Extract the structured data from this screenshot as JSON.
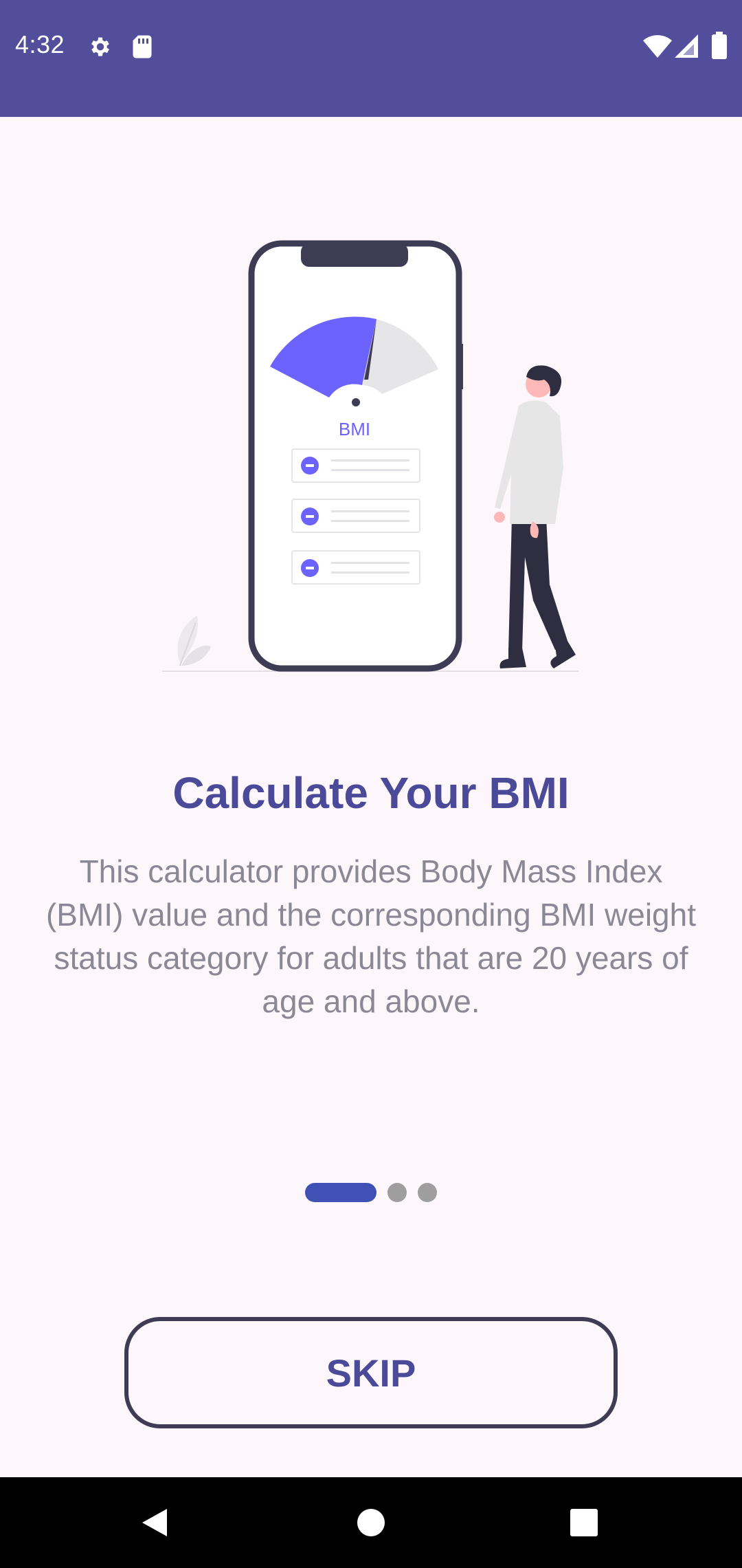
{
  "status_bar": {
    "time": "4:32",
    "icons": [
      "gear-icon",
      "sd-card-icon",
      "wifi-icon",
      "signal-icon",
      "battery-icon"
    ],
    "color": "#534e9b"
  },
  "illustration": {
    "gauge_label": "BMI",
    "accent_color": "#6c63ff"
  },
  "onboarding": {
    "title": "Calculate Your BMI",
    "description": "This calculator provides Body Mass Index (BMI) value and the corresponding BMI weight status category for adults that are 20 years of age and above.",
    "current_page": 1,
    "total_pages": 3
  },
  "actions": {
    "skip_label": "SKIP"
  },
  "nav_bar": {
    "buttons": [
      "back-icon",
      "home-icon",
      "recents-icon"
    ]
  }
}
